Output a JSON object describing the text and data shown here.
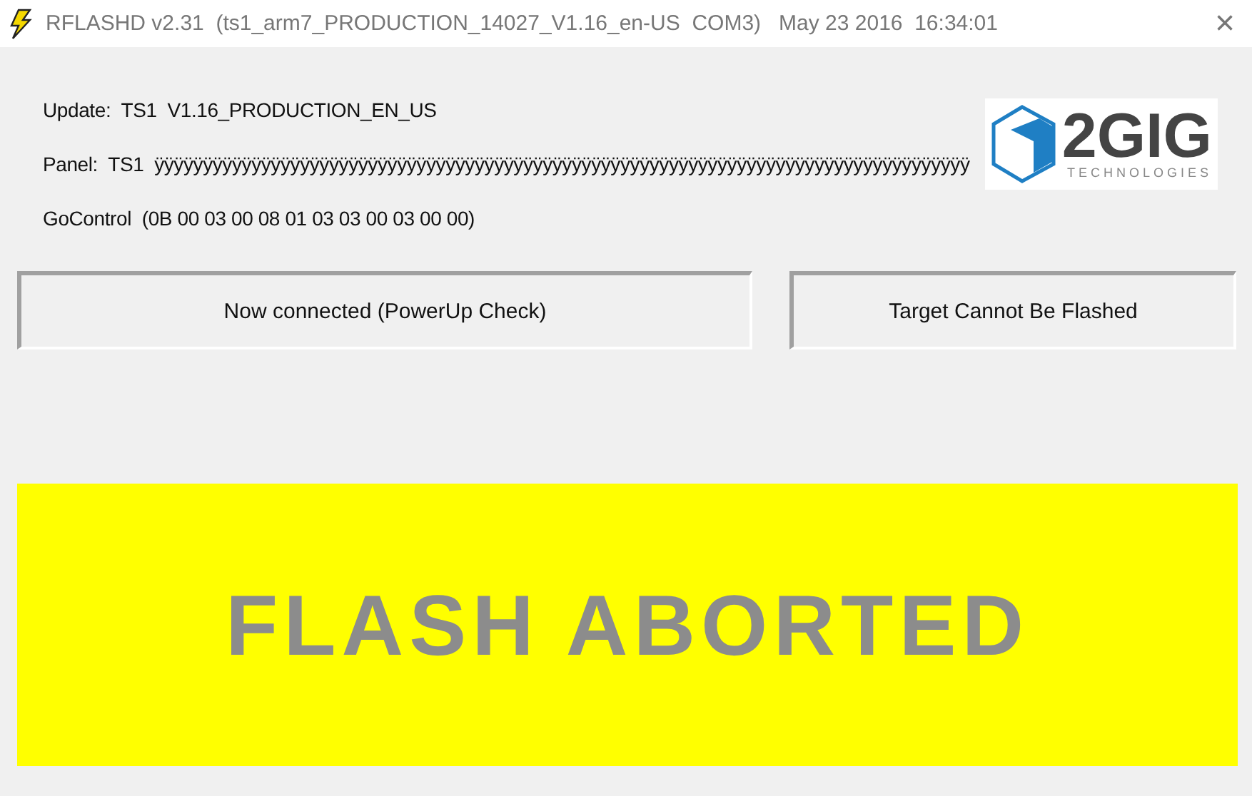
{
  "window": {
    "title": "RFLASHD v2.31  (ts1_arm7_PRODUCTION_14027_V1.16_en-US  COM3)   May 23 2016  16:34:01",
    "close": "×"
  },
  "info": [
    {
      "label": "Update:",
      "value": "TS1  V1.16_PRODUCTION_EN_US"
    },
    {
      "label": "Panel:",
      "value": "TS1  ÿÿÿÿÿÿÿÿÿÿÿÿÿÿÿÿÿÿÿÿÿÿÿÿÿÿÿÿÿÿÿÿÿÿÿÿÿÿÿÿÿÿÿÿÿÿÿÿÿÿÿÿÿÿÿÿÿÿÿÿÿÿÿÿÿÿÿÿÿÿÿÿÿÿÿÿÿÿÿÿÿÿÿÿ"
    },
    {
      "label": "GoControl",
      "value": "(0B 00 03 00 08 01 03 03 00 03 00 00)"
    }
  ],
  "logo": {
    "name": "2GIG",
    "tagline": "TECHNOLOGIES"
  },
  "status": [
    "Now connected (PowerUp Check)",
    "Target Cannot Be Flashed"
  ],
  "banner": {
    "text": "FLASH ABORTED",
    "color": "#ffff00"
  }
}
